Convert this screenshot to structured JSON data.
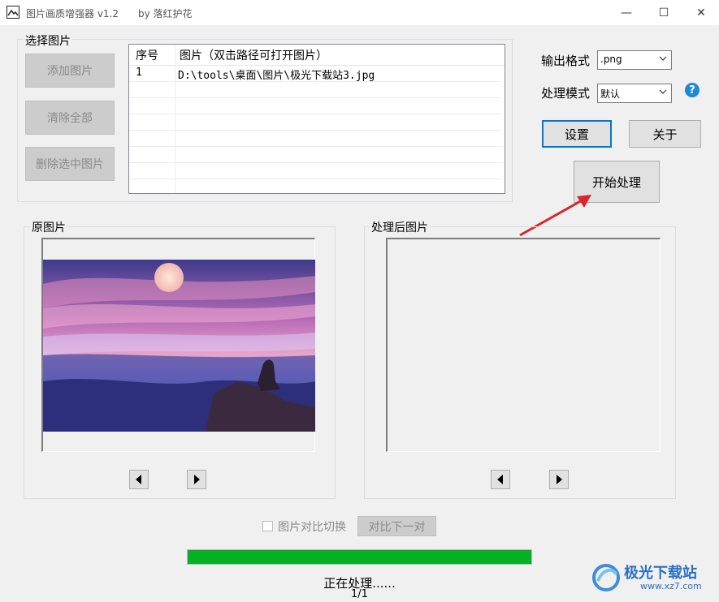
{
  "window": {
    "title": "图片画质增强器 v1.2",
    "author": "by 落红护花",
    "minimize_glyph": "—",
    "maximize_glyph": "☐",
    "close_glyph": "✕"
  },
  "select_group": {
    "label": "选择图片",
    "add_button": "添加图片",
    "clear_button": "清除全部",
    "delete_button": "删除选中图片"
  },
  "file_list": {
    "columns": [
      "序号",
      "图片（双击路径可打开图片）"
    ],
    "rows": [
      {
        "index": "1",
        "path": "D:\\tools\\桌面\\图片\\极光下载站3.jpg"
      }
    ]
  },
  "options": {
    "output_format_label": "输出格式",
    "output_format_value": ".png",
    "mode_label": "处理模式",
    "mode_value": "默认",
    "help_icon": "?"
  },
  "buttons": {
    "settings": "设置",
    "about": "关于",
    "start": "开始处理"
  },
  "original_panel": {
    "label": "原图片"
  },
  "processed_panel": {
    "label": "处理后图片"
  },
  "compare": {
    "checkbox_label": "图片对比切换",
    "checkbox_checked": false,
    "next_pair_button": "对比下一对"
  },
  "progress": {
    "percent": 100,
    "color": "#06b025",
    "status": "正在处理......",
    "count": "1/1"
  },
  "watermark": {
    "text": "极光下载站",
    "url": "www.xz7.com"
  },
  "colors": {
    "annotation_arrow": "#d9262a",
    "accent_blue": "#0078d7"
  }
}
